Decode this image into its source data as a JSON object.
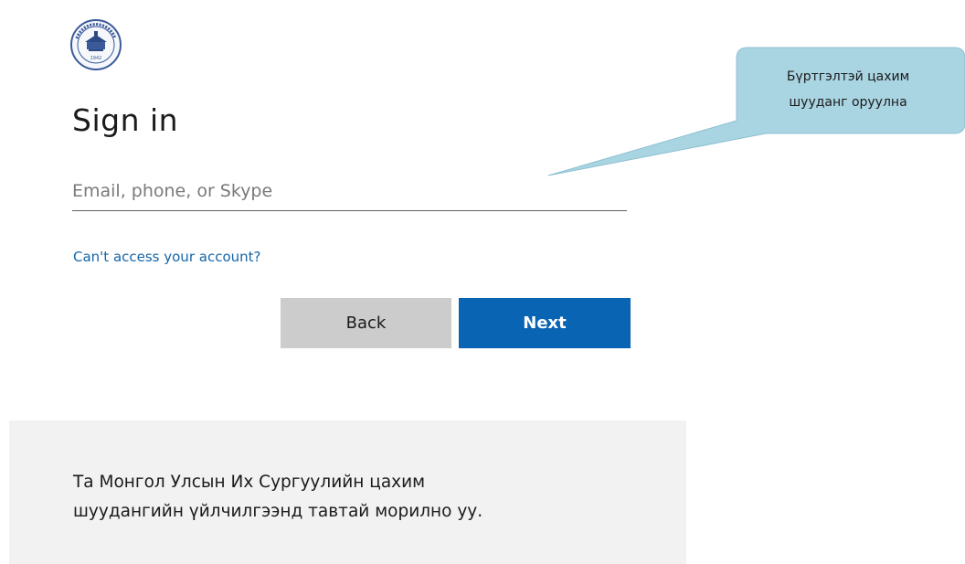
{
  "colors": {
    "accent": "#0a64b4",
    "link": "#1565a8",
    "callout": "#a9d4e2",
    "banner": "#f2f2f2"
  },
  "logo": {
    "icon": "university-seal-icon"
  },
  "signin": {
    "title": "Sign in",
    "email_placeholder": "Email, phone, or Skype",
    "email_value": "",
    "help_link": "Can't access your account?",
    "back_label": "Back",
    "next_label": "Next"
  },
  "banner": {
    "text": "Та Монгол Улсын Их Сургуулийн цахим\nшуудангийн үйлчилгээнд тавтай морилно уу."
  },
  "callout": {
    "text": "Бүртгэлтэй цахим\nшууданг оруулна"
  }
}
